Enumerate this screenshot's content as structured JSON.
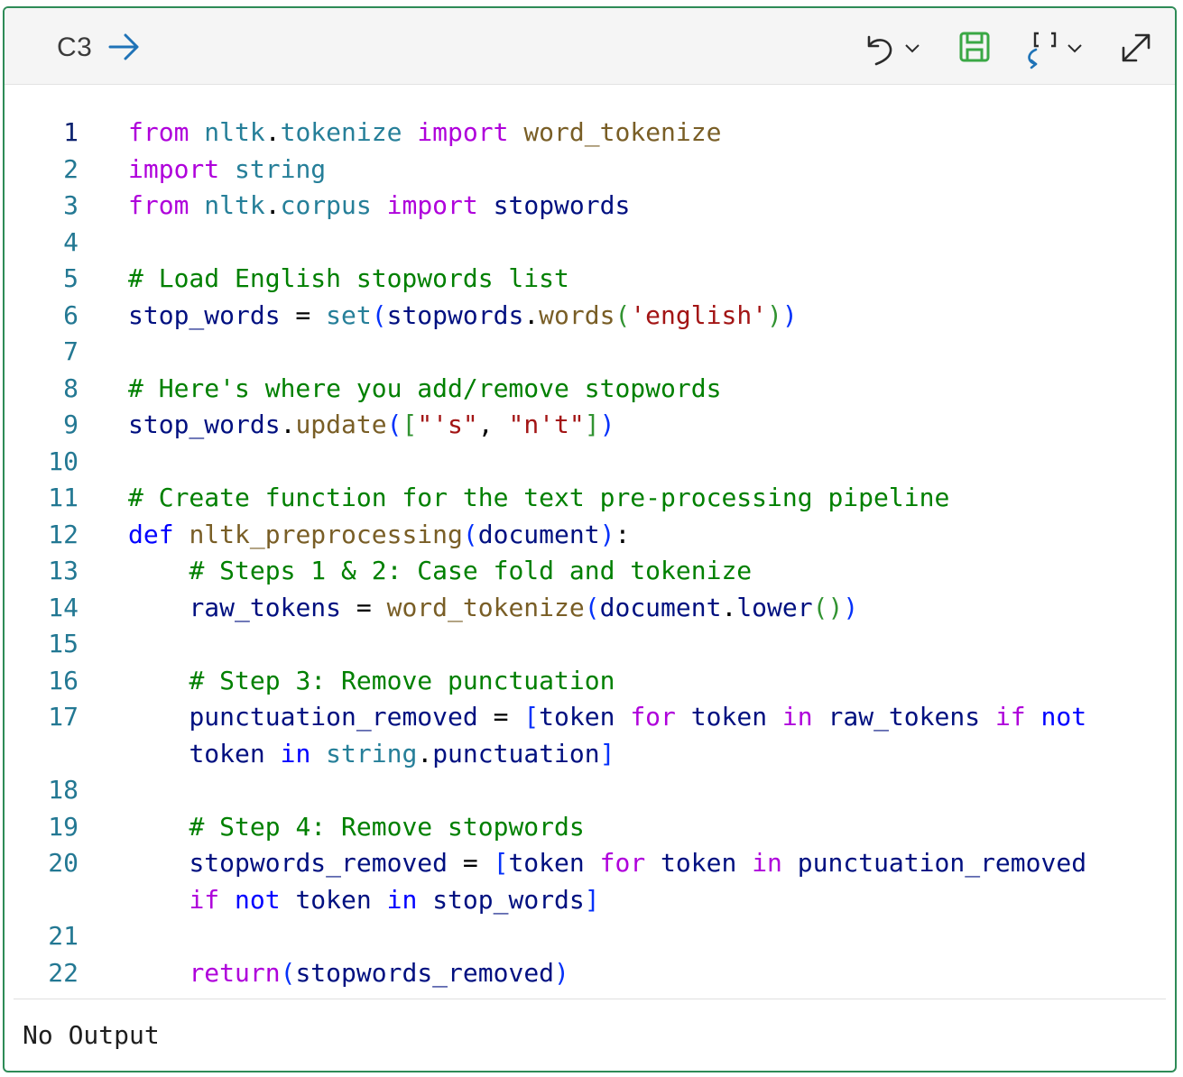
{
  "cell": {
    "id": "C3",
    "output_text": "No Output",
    "accent_color": "#2e8b57"
  },
  "toolbar": {
    "buttons": [
      "run-arrow-icon",
      "undo-icon",
      "save-icon",
      "variables-icon",
      "expand-icon"
    ]
  },
  "code": {
    "lines": [
      {
        "n": "1",
        "t": [
          [
            "k",
            "from"
          ],
          [
            "o",
            " "
          ],
          [
            "m",
            "nltk"
          ],
          [
            "o",
            "."
          ],
          [
            "m",
            "tokenize"
          ],
          [
            "o",
            " "
          ],
          [
            "k",
            "import"
          ],
          [
            "o",
            " "
          ],
          [
            "f",
            "word_tokenize"
          ]
        ]
      },
      {
        "n": "2",
        "t": [
          [
            "k",
            "import"
          ],
          [
            "o",
            " "
          ],
          [
            "m",
            "string"
          ]
        ]
      },
      {
        "n": "3",
        "t": [
          [
            "k",
            "from"
          ],
          [
            "o",
            " "
          ],
          [
            "m",
            "nltk"
          ],
          [
            "o",
            "."
          ],
          [
            "m",
            "corpus"
          ],
          [
            "o",
            " "
          ],
          [
            "k",
            "import"
          ],
          [
            "o",
            " "
          ],
          [
            "v",
            "stopwords"
          ]
        ]
      },
      {
        "n": "4",
        "t": []
      },
      {
        "n": "5",
        "t": [
          [
            "c",
            "# Load English stopwords list"
          ]
        ]
      },
      {
        "n": "6",
        "t": [
          [
            "v",
            "stop_words"
          ],
          [
            "o",
            " = "
          ],
          [
            "m",
            "set"
          ],
          [
            "p1",
            "("
          ],
          [
            "v",
            "stopwords"
          ],
          [
            "o",
            "."
          ],
          [
            "f",
            "words"
          ],
          [
            "p2",
            "("
          ],
          [
            "s",
            "'english'"
          ],
          [
            "p2",
            ")"
          ],
          [
            "p1",
            ")"
          ]
        ]
      },
      {
        "n": "7",
        "t": []
      },
      {
        "n": "8",
        "t": [
          [
            "c",
            "# Here's where you add/remove stopwords"
          ]
        ]
      },
      {
        "n": "9",
        "t": [
          [
            "v",
            "stop_words"
          ],
          [
            "o",
            "."
          ],
          [
            "f",
            "update"
          ],
          [
            "p1",
            "("
          ],
          [
            "p2",
            "["
          ],
          [
            "s",
            "\"'s\""
          ],
          [
            "o",
            ", "
          ],
          [
            "s",
            "\"n't\""
          ],
          [
            "p2",
            "]"
          ],
          [
            "p1",
            ")"
          ]
        ]
      },
      {
        "n": "10",
        "t": []
      },
      {
        "n": "11",
        "t": [
          [
            "c",
            "# Create function for the text pre-processing pipeline"
          ]
        ]
      },
      {
        "n": "12",
        "t": [
          [
            "kb",
            "def"
          ],
          [
            "o",
            " "
          ],
          [
            "f",
            "nltk_preprocessing"
          ],
          [
            "p1",
            "("
          ],
          [
            "v",
            "document"
          ],
          [
            "p1",
            ")"
          ],
          [
            "o",
            ":"
          ]
        ]
      },
      {
        "n": "13",
        "t": [
          [
            "o",
            "    "
          ],
          [
            "c",
            "# Steps 1 & 2: Case fold and tokenize"
          ]
        ]
      },
      {
        "n": "14",
        "t": [
          [
            "o",
            "    "
          ],
          [
            "v",
            "raw_tokens"
          ],
          [
            "o",
            " = "
          ],
          [
            "f",
            "word_tokenize"
          ],
          [
            "p1",
            "("
          ],
          [
            "v",
            "document"
          ],
          [
            "o",
            "."
          ],
          [
            "v",
            "lower"
          ],
          [
            "p2",
            "()"
          ],
          [
            "p1",
            ")"
          ]
        ]
      },
      {
        "n": "15",
        "t": []
      },
      {
        "n": "16",
        "t": [
          [
            "o",
            "    "
          ],
          [
            "c",
            "# Step 3: Remove punctuation"
          ]
        ]
      },
      {
        "n": "17",
        "t": [
          [
            "o",
            "    "
          ],
          [
            "v",
            "punctuation_removed"
          ],
          [
            "o",
            " = "
          ],
          [
            "p1",
            "["
          ],
          [
            "v",
            "token"
          ],
          [
            "o",
            " "
          ],
          [
            "k",
            "for"
          ],
          [
            "o",
            " "
          ],
          [
            "v",
            "token"
          ],
          [
            "o",
            " "
          ],
          [
            "k",
            "in"
          ],
          [
            "o",
            " "
          ],
          [
            "v",
            "raw_tokens"
          ],
          [
            "o",
            " "
          ],
          [
            "k",
            "if"
          ],
          [
            "o",
            " "
          ],
          [
            "kb",
            "not"
          ]
        ]
      },
      {
        "n": "",
        "t": [
          [
            "o",
            "    "
          ],
          [
            "v",
            "token"
          ],
          [
            "o",
            " "
          ],
          [
            "kb",
            "in"
          ],
          [
            "o",
            " "
          ],
          [
            "m",
            "string"
          ],
          [
            "o",
            "."
          ],
          [
            "v",
            "punctuation"
          ],
          [
            "p1",
            "]"
          ]
        ]
      },
      {
        "n": "18",
        "t": []
      },
      {
        "n": "19",
        "t": [
          [
            "o",
            "    "
          ],
          [
            "c",
            "# Step 4: Remove stopwords"
          ]
        ]
      },
      {
        "n": "20",
        "t": [
          [
            "o",
            "    "
          ],
          [
            "v",
            "stopwords_removed"
          ],
          [
            "o",
            " = "
          ],
          [
            "p1",
            "["
          ],
          [
            "v",
            "token"
          ],
          [
            "o",
            " "
          ],
          [
            "k",
            "for"
          ],
          [
            "o",
            " "
          ],
          [
            "v",
            "token"
          ],
          [
            "o",
            " "
          ],
          [
            "k",
            "in"
          ],
          [
            "o",
            " "
          ],
          [
            "v",
            "punctuation_removed"
          ]
        ]
      },
      {
        "n": "",
        "t": [
          [
            "o",
            "    "
          ],
          [
            "k",
            "if"
          ],
          [
            "o",
            " "
          ],
          [
            "kb",
            "not"
          ],
          [
            "o",
            " "
          ],
          [
            "v",
            "token"
          ],
          [
            "o",
            " "
          ],
          [
            "kb",
            "in"
          ],
          [
            "o",
            " "
          ],
          [
            "v",
            "stop_words"
          ],
          [
            "p1",
            "]"
          ]
        ]
      },
      {
        "n": "21",
        "t": []
      },
      {
        "n": "22",
        "t": [
          [
            "o",
            "    "
          ],
          [
            "k",
            "return"
          ],
          [
            "p1",
            "("
          ],
          [
            "v",
            "stopwords_removed"
          ],
          [
            "p1",
            ")"
          ]
        ]
      }
    ]
  }
}
